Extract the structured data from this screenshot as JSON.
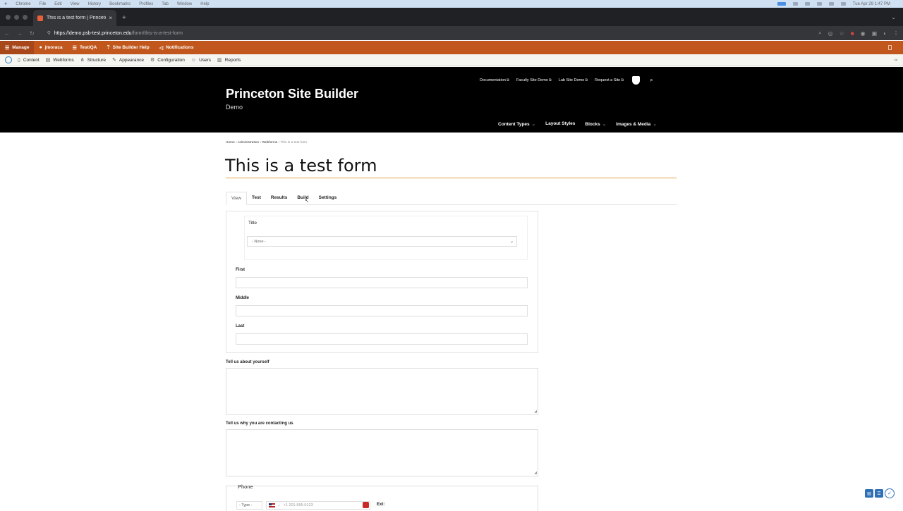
{
  "macos": {
    "menu": [
      "Chrome",
      "File",
      "Edit",
      "View",
      "History",
      "Bookmarks",
      "Profiles",
      "Tab",
      "Window",
      "Help"
    ],
    "clock": "Tue Apr 29  1:47 PM"
  },
  "browser": {
    "tab_title": "This is a test form | Princeton",
    "tab_close": "×",
    "new_tab": "+",
    "url_host": "https://demo.psb-test.princeton.edu",
    "url_path": "/form/this-is-a-test-form"
  },
  "admin_toolbar": {
    "manage": "Manage",
    "user": "jmoraca",
    "testqa": "Test/QA",
    "help": "Site Builder Help",
    "notifications": "Notifications"
  },
  "admin_menu": [
    "Content",
    "Webforms",
    "Structure",
    "Appearance",
    "Configuration",
    "Users",
    "Reports"
  ],
  "site": {
    "title": "Princeton Site Builder",
    "subtitle": "Demo",
    "utility_links": [
      "Documentation",
      "Faculty Site Demo",
      "Lab Site Demo",
      "Request a Site"
    ],
    "main_nav": [
      "Content Types",
      "Layout Styles",
      "Blocks",
      "Images & Media"
    ]
  },
  "breadcrumb": {
    "items": [
      "Home",
      "Administration",
      "Webforms"
    ],
    "current": "This is a test form",
    "sep": " › "
  },
  "page": {
    "title": "This is a test form",
    "tabs": [
      "View",
      "Test",
      "Results",
      "Build",
      "Settings"
    ]
  },
  "form": {
    "title_label": "Title",
    "title_select": "- None -",
    "first_label": "First",
    "middle_label": "Middle",
    "last_label": "Last",
    "about_label": "Tell us about yourself",
    "contact_label": "Tell us why you are contacting us",
    "phone_legend": "Phone",
    "phone_type": "- Type -",
    "phone_placeholder": "+1 201-555-0123",
    "ext_label": "Ext:"
  },
  "colors": {
    "admin_toolbar": "#c1571c",
    "header_bg": "#000000",
    "title_rule": "#e0a640"
  }
}
